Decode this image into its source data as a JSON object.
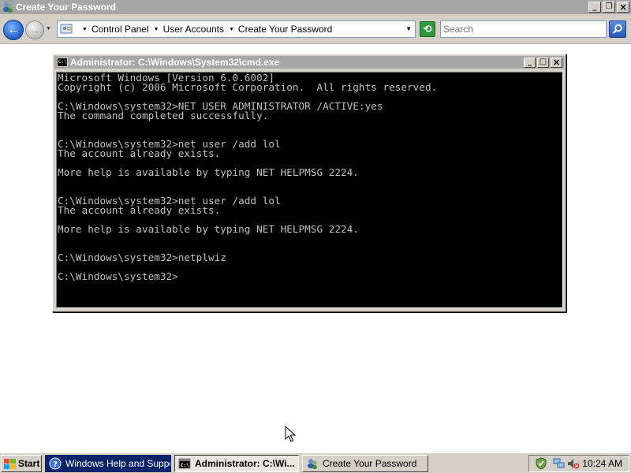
{
  "window": {
    "title": "Create Your Password"
  },
  "address_bar": {
    "breadcrumbs": [
      "Control Panel",
      "User Accounts",
      "Create Your Password"
    ]
  },
  "search": {
    "placeholder": "Search"
  },
  "cmd_window": {
    "title": "Administrator: C:\\Windows\\System32\\cmd.exe",
    "lines": [
      "Microsoft Windows [Version 6.0.6002]",
      "Copyright (c) 2006 Microsoft Corporation.  All rights reserved.",
      "",
      "C:\\Windows\\system32>NET USER ADMINISTRATOR /ACTIVE:yes",
      "The command completed successfully.",
      "",
      "",
      "C:\\Windows\\system32>net user /add lol",
      "The account already exists.",
      "",
      "More help is available by typing NET HELPMSG 2224.",
      "",
      "",
      "C:\\Windows\\system32>net user /add lol",
      "The account already exists.",
      "",
      "More help is available by typing NET HELPMSG 2224.",
      "",
      "",
      "C:\\Windows\\system32>netplwiz",
      "",
      "C:\\Windows\\system32>"
    ]
  },
  "taskbar": {
    "start_label": "Start",
    "tasks": [
      {
        "label": "Windows Help and Support"
      },
      {
        "label": "Administrator: C:\\Wi..."
      },
      {
        "label": "Create Your Password"
      }
    ],
    "clock": "10:24 AM"
  },
  "icons": {
    "titlebar": "user-accounts-icon",
    "back": "back-arrow-icon",
    "forward": "forward-arrow-icon",
    "refresh": "refresh-icon",
    "search": "magnifier-icon",
    "tray": [
      "network-icon",
      "volume-muted-icon"
    ]
  },
  "colors": {
    "inactive_titlebar": "#a6a6a6",
    "console_bg": "#000000",
    "console_text": "#c0c0c0",
    "active_task": "#0a246a"
  }
}
